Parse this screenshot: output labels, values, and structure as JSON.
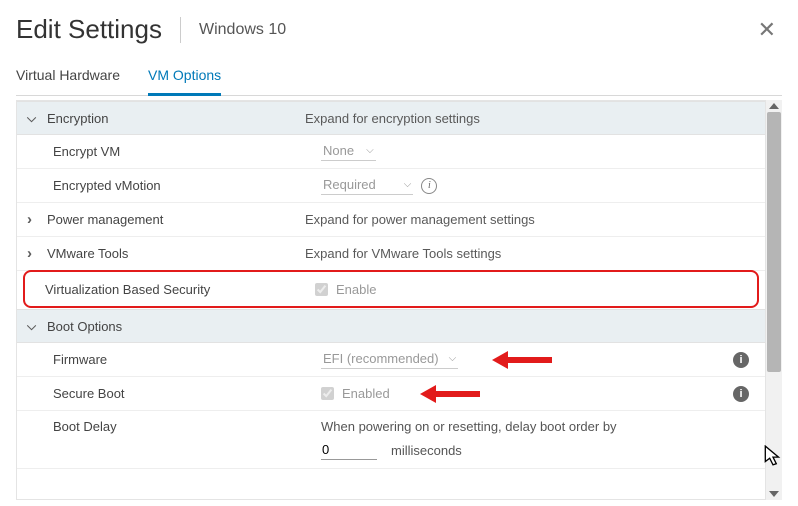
{
  "header": {
    "title": "Edit Settings",
    "subtitle": "Windows 10"
  },
  "tabs": {
    "virtual_hardware": "Virtual Hardware",
    "vm_options": "VM Options"
  },
  "encryption": {
    "title": "Encryption",
    "summary": "Expand for encryption settings",
    "encrypt_vm_label": "Encrypt VM",
    "encrypt_vm_value": "None",
    "vmotion_label": "Encrypted vMotion",
    "vmotion_value": "Required"
  },
  "power": {
    "title": "Power management",
    "summary": "Expand for power management settings"
  },
  "tools": {
    "title": "VMware Tools",
    "summary": "Expand for VMware Tools settings"
  },
  "vbs": {
    "title": "Virtualization Based Security",
    "checkbox_label": "Enable"
  },
  "boot": {
    "title": "Boot Options",
    "firmware_label": "Firmware",
    "firmware_value": "EFI (recommended)",
    "secure_boot_label": "Secure Boot",
    "secure_boot_checkbox_label": "Enabled",
    "delay_label": "Boot Delay",
    "delay_text": "When powering on or resetting, delay boot order by",
    "delay_value": "0",
    "delay_unit": "milliseconds"
  }
}
